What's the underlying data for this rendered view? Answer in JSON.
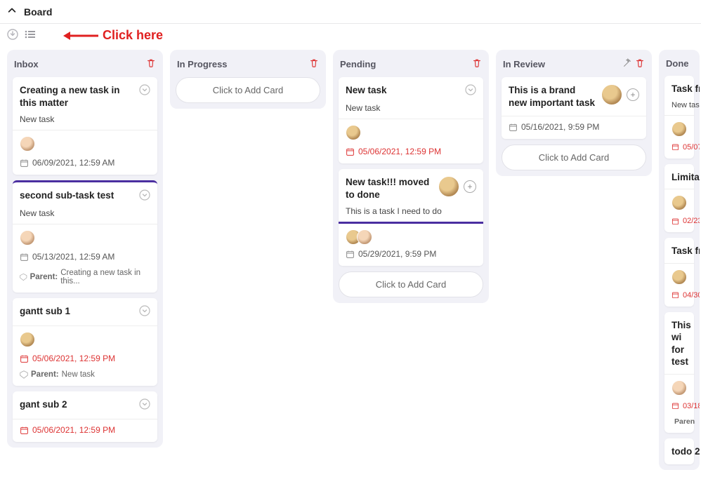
{
  "header": {
    "title": "Board"
  },
  "hint": {
    "text": "Click here"
  },
  "columns": [
    {
      "key": "inbox",
      "title": "Inbox",
      "cards": [
        {
          "title": "Creating a new task in this matter",
          "sub": "New task",
          "date": "06/09/2021, 12:59 AM",
          "overdue": false,
          "avatars": [
            "a1"
          ]
        },
        {
          "title": "second sub-task test",
          "sub": "New task",
          "date": "05/13/2021, 12:59 AM",
          "overdue": false,
          "avatars": [
            "a1"
          ],
          "parent": "Creating a new task in this...",
          "purple": true
        },
        {
          "title": "gantt sub 1",
          "sub": "",
          "date": "05/06/2021, 12:59 PM",
          "overdue": true,
          "avatars": [
            "a2"
          ],
          "parent": "New task"
        },
        {
          "title": "gant sub 2",
          "sub": "",
          "date": "05/06/2021, 12:59 PM",
          "overdue": true,
          "avatars": []
        }
      ]
    },
    {
      "key": "inprogress",
      "title": "In Progress",
      "add_label": "Click to Add Card",
      "cards": []
    },
    {
      "key": "pending",
      "title": "Pending",
      "add_label": "Click to Add Card",
      "cards": [
        {
          "title": "New task",
          "sub": "New task",
          "date": "05/06/2021, 12:59 PM",
          "overdue": true,
          "avatars": [
            "a2"
          ]
        },
        {
          "title": "New task!!! moved to done",
          "sub": "This is a task I need to do",
          "date": "05/29/2021, 9:59 PM",
          "overdue": false,
          "avatars": [
            "a2",
            "a1"
          ],
          "assignAvatar": "a2",
          "purple_bottom": true
        }
      ]
    },
    {
      "key": "inreview",
      "title": "In Review",
      "wand": true,
      "add_label": "Click to Add Card",
      "cards": [
        {
          "title": "This is a brand new important task",
          "sub": "",
          "date": "05/16/2021, 9:59 PM",
          "overdue": false,
          "avatars": [],
          "assignAvatar": "a2"
        }
      ]
    },
    {
      "key": "done",
      "title": "Done",
      "cards_preview": [
        {
          "title": "Task fr",
          "sub": "New task",
          "date": "05/07",
          "overdue": true,
          "avatars": [
            "a2"
          ]
        },
        {
          "title": "Limitat",
          "date": "02/23",
          "overdue": true,
          "avatars": [
            "a2"
          ]
        },
        {
          "title": "Task fr",
          "date": "04/30",
          "overdue": true,
          "avatars": [
            "a2"
          ]
        },
        {
          "title": "This wi for test",
          "date": "03/18",
          "overdue": true,
          "avatars": [
            "a1"
          ],
          "parent": "Parent"
        },
        {
          "title": "todo 2"
        }
      ]
    }
  ]
}
